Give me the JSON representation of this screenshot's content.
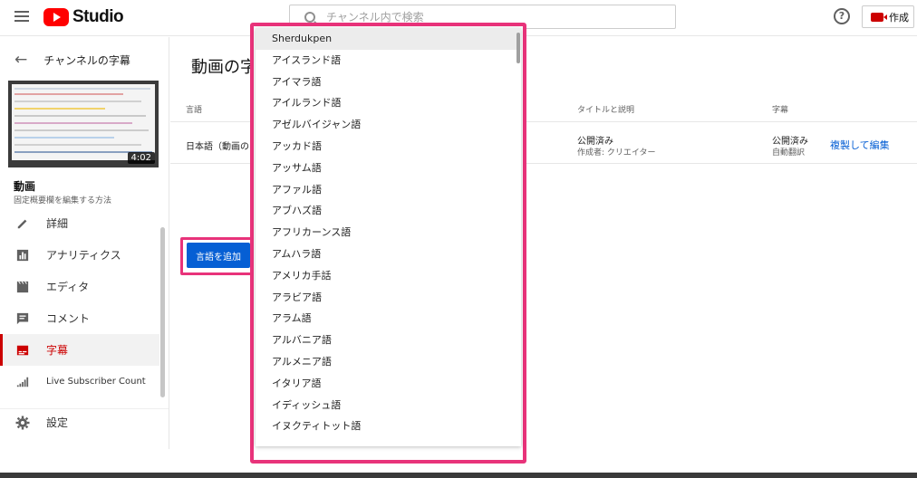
{
  "topbar": {
    "logo_text": "Studio",
    "search_placeholder": "チャンネル内で検索",
    "help_glyph": "?",
    "create_label": "作成"
  },
  "sidebar": {
    "back_label": "チャンネルの字幕",
    "thumbnail_duration": "4:02",
    "video_title": "動画",
    "video_subtitle": "固定概要欄を編集する方法",
    "items": [
      {
        "label": "詳細",
        "icon": "pencil-icon",
        "active": false
      },
      {
        "label": "アナリティクス",
        "icon": "analytics-icon",
        "active": false
      },
      {
        "label": "エディタ",
        "icon": "clapperboard-icon",
        "active": false
      },
      {
        "label": "コメント",
        "icon": "comment-icon",
        "active": false
      },
      {
        "label": "字幕",
        "icon": "subtitles-icon",
        "active": true
      },
      {
        "label": "Live Subscriber Count",
        "icon": "signal-bars-icon",
        "active": false
      }
    ],
    "settings_label": "設定"
  },
  "main": {
    "title": "動画の字",
    "table": {
      "headers": {
        "language": "言語",
        "title_desc": "タイトルと説明",
        "subtitles": "字幕"
      },
      "row": {
        "language": "日本語（動画の",
        "title_status": "公開済み",
        "title_author": "作成者: クリエイター",
        "subtitle_status": "公開済み",
        "subtitle_source": "自動翻訳",
        "action": "複製して編集"
      }
    },
    "add_language_button": "言語を追加"
  },
  "dropdown": {
    "selected_index": 0,
    "options": [
      "Sherdukpen",
      "アイスランド語",
      "アイマラ語",
      "アイルランド語",
      "アゼルバイジャン語",
      "アッカド語",
      "アッサム語",
      "アファル語",
      "アブハズ語",
      "アフリカーンス語",
      "アムハラ語",
      "アメリカ手話",
      "アラビア語",
      "アラム語",
      "アルバニア語",
      "アルメニア語",
      "イタリア語",
      "イディッシュ語",
      "イヌクティトット語"
    ]
  },
  "colors": {
    "accent_red": "#cc0000",
    "link_blue": "#065fd4",
    "highlight_pink": "#e8337a"
  }
}
